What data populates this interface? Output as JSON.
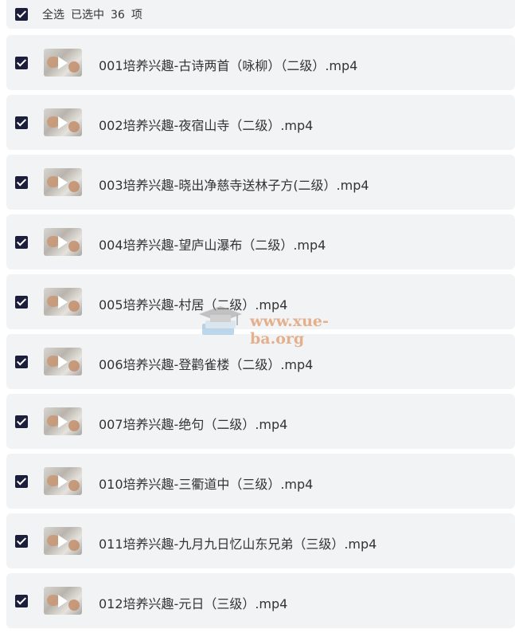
{
  "header": {
    "select_all": "全选",
    "selected_prefix": "已选中",
    "count": "36",
    "unit": "项"
  },
  "files": [
    {
      "name": "001培养兴趣-古诗两首（咏柳）（二级）.mp4"
    },
    {
      "name": "002培养兴趣-夜宿山寺（二级）.mp4"
    },
    {
      "name": "003培养兴趣-晓出净慈寺送林子方(二级）.mp4"
    },
    {
      "name": "004培养兴趣-望庐山瀑布（二级）.mp4"
    },
    {
      "name": "005培养兴趣-村居（二级）.mp4"
    },
    {
      "name": "006培养兴趣-登鹳雀楼（二级）.mp4"
    },
    {
      "name": "007培养兴趣-绝句（二级）.mp4"
    },
    {
      "name": "010培养兴趣-三衢道中（三级）.mp4"
    },
    {
      "name": "011培养兴趣-九月九日忆山东兄弟（三级）.mp4"
    },
    {
      "name": "012培养兴趣-元日（三级）.mp4"
    }
  ],
  "watermark": {
    "text": "www.xue-ba.org"
  }
}
